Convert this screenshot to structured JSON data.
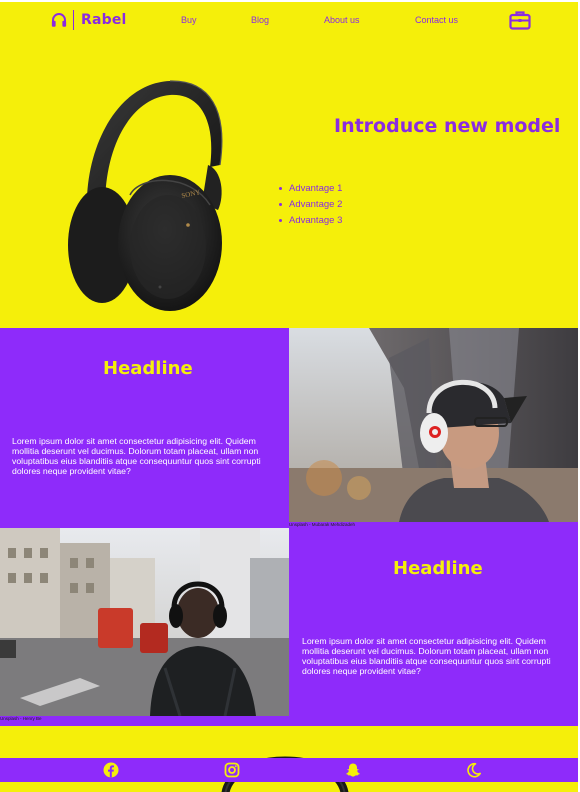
{
  "header": {
    "brand": "Rabel",
    "nav": [
      "Buy",
      "Blog",
      "About us",
      "Contact us"
    ]
  },
  "hero": {
    "title": "Introduce new model",
    "advantages": [
      "Advantage 1",
      "Advantage 2",
      "Advantage 3"
    ],
    "product_brand": "SONY"
  },
  "section1": {
    "headline": "Headline",
    "body": "Lorem ipsum dolor sit amet consectetur adipisicing elit. Quidem mollitia deserunt vel ducimus. Dolorum totam placeat, ullam non voluptatibus eius blanditiis atque consequuntur quos sint corrupti dolores neque provident vitae?",
    "image_caption": "Unsplash - Mubarak Mehdizadeh"
  },
  "section2": {
    "headline": "Headline",
    "body": "Lorem ipsum dolor sit amet consectetur adipisicing elit. Quidem mollitia deserunt vel ducimus. Dolorum totam placeat, ullam non voluptatibus eius blanditiis atque consequuntur quos sint corrupti dolores neque provident vitae?",
    "image_caption": "Unsplash - Henry Be"
  },
  "footer": {
    "icons": [
      "facebook-icon",
      "instagram-icon",
      "snapchat-icon",
      "moon-icon"
    ]
  },
  "colors": {
    "yellow": "#f5ef0a",
    "purple": "#8e2bfa",
    "purple_text": "#8a2be2"
  }
}
